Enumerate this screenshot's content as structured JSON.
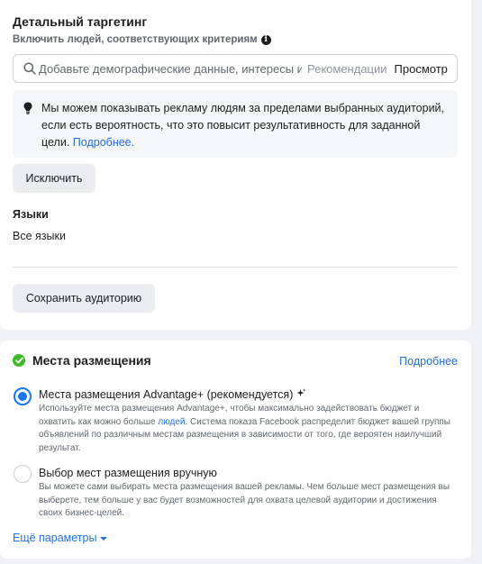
{
  "targeting": {
    "title": "Детальный таргетинг",
    "subtitle": "Включить людей, соответствующих критериям",
    "search": {
      "placeholder": "Добавьте демографические данные, интересы или поведение",
      "recommendations": "Рекомендации",
      "browse": "Просмотр"
    },
    "notice": {
      "text": "Мы можем показывать рекламу людям за пределами выбранных аудиторий, если есть вероятность, что это повысит результативность для заданной цели.",
      "link": "Подробнее."
    },
    "exclude_button": "Исключить"
  },
  "languages": {
    "title": "Языки",
    "value": "Все языки"
  },
  "save_audience_button": "Сохранить аудиторию",
  "placements": {
    "title": "Места размещения",
    "more_link": "Подробнее",
    "option_advantage": {
      "label": "Места размещения Advantage+ (рекомендуется)",
      "desc_before_link": "Используйте места размещения Advantage+, чтобы максимально задействовать бюджет и охватить как можно больше ",
      "desc_link": "людей",
      "desc_after_link": ". Система показа Facebook распределит бюджет вашей группы объявлений по различным местам размещения в зависимости от того, где вероятен наилучший результат.",
      "selected": true
    },
    "option_manual": {
      "label": "Выбор мест размещения вручную",
      "desc": "Вы можете сами выбирать места размещения вашей рекламы. Чем больше мест размещения вы выберете, тем больше у вас будет возможностей для охвата целевой аудитории и достижения своих бизнес-целей.",
      "selected": false
    },
    "more_params": "Ещё параметры"
  },
  "colors": {
    "link": "#216fdb",
    "radio_selected": "#1877f2",
    "check_green": "#42b72a"
  }
}
